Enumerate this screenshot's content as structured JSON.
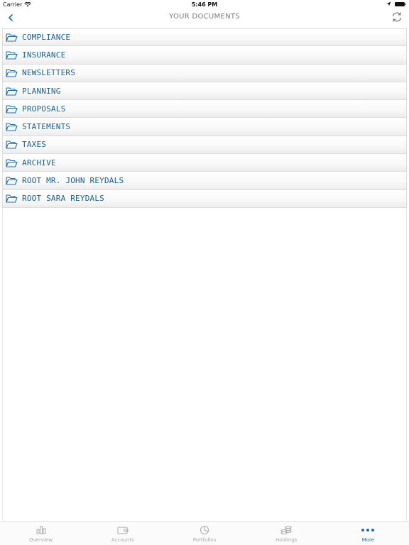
{
  "status_bar": {
    "carrier": "Carrier",
    "time": "5:46 PM"
  },
  "nav": {
    "title": "YOUR DOCUMENTS"
  },
  "folders": [
    {
      "label": "COMPLIANCE"
    },
    {
      "label": "INSURANCE"
    },
    {
      "label": "NEWSLETTERS"
    },
    {
      "label": "PLANNING"
    },
    {
      "label": "PROPOSALS"
    },
    {
      "label": "STATEMENTS"
    },
    {
      "label": "TAXES"
    },
    {
      "label": "ARCHIVE"
    },
    {
      "label": "ROOT MR. JOHN REYDALS"
    },
    {
      "label": "ROOT SARA REYDALS"
    }
  ],
  "tabs": [
    {
      "label": "Overview",
      "icon": "overview-icon",
      "active": false
    },
    {
      "label": "Accounts",
      "icon": "wallet-icon",
      "active": false
    },
    {
      "label": "Portfolios",
      "icon": "pie-chart-icon",
      "active": false
    },
    {
      "label": "Holdings",
      "icon": "coins-icon",
      "active": false
    },
    {
      "label": "More",
      "icon": "more-icon",
      "active": true
    }
  ],
  "colors": {
    "accent": "#1f6da6",
    "folder_text": "#1b5f8e",
    "tab_inactive": "#aaaaaa"
  }
}
